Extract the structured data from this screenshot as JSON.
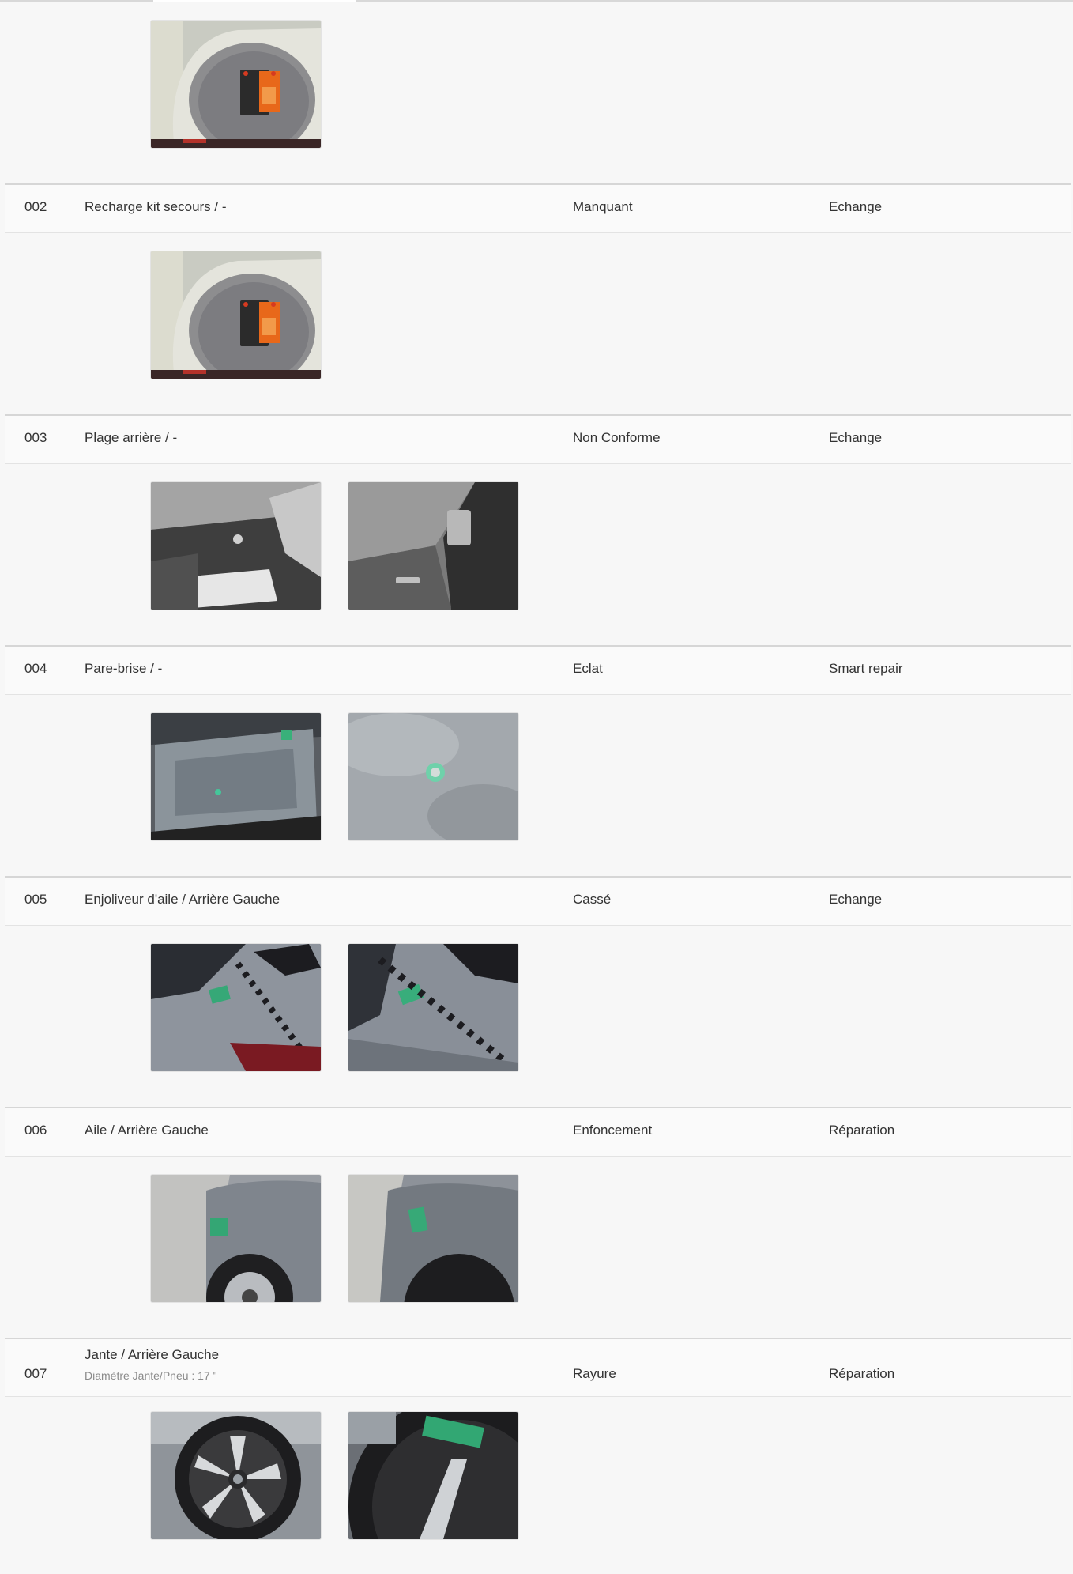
{
  "items": [
    {
      "number": "002",
      "label": "Recharge kit secours / -",
      "damage": "Manquant",
      "action": "Echange",
      "photos": [
        "battery-compartment"
      ]
    },
    {
      "number": "003",
      "label": "Plage arrière / -",
      "damage": "Non Conforme",
      "action": "Echange",
      "photos": [
        "trunk-shelf",
        "trunk-shelf-detail"
      ]
    },
    {
      "number": "004",
      "label": "Pare-brise / -",
      "damage": "Eclat",
      "action": "Smart repair",
      "photos": [
        "windshield",
        "windshield-chip"
      ]
    },
    {
      "number": "005",
      "label": "Enjoliveur d'aile / Arrière Gauche",
      "damage": "Cassé",
      "action": "Echange",
      "photos": [
        "rear-pillar-trim",
        "rear-pillar-trim-detail"
      ]
    },
    {
      "number": "006",
      "label": "Aile / Arrière Gauche",
      "damage": "Enfoncement",
      "action": "Réparation",
      "photos": [
        "rear-wing",
        "rear-wing-detail"
      ]
    },
    {
      "number": "007",
      "label": "Jante / Arrière Gauche",
      "sublabel": "Diamètre Jante/Pneu : 17 \"",
      "damage": "Rayure",
      "action": "Réparation",
      "photos": [
        "rim",
        "rim-detail"
      ]
    }
  ],
  "first_item_photos": [
    "battery-compartment"
  ]
}
